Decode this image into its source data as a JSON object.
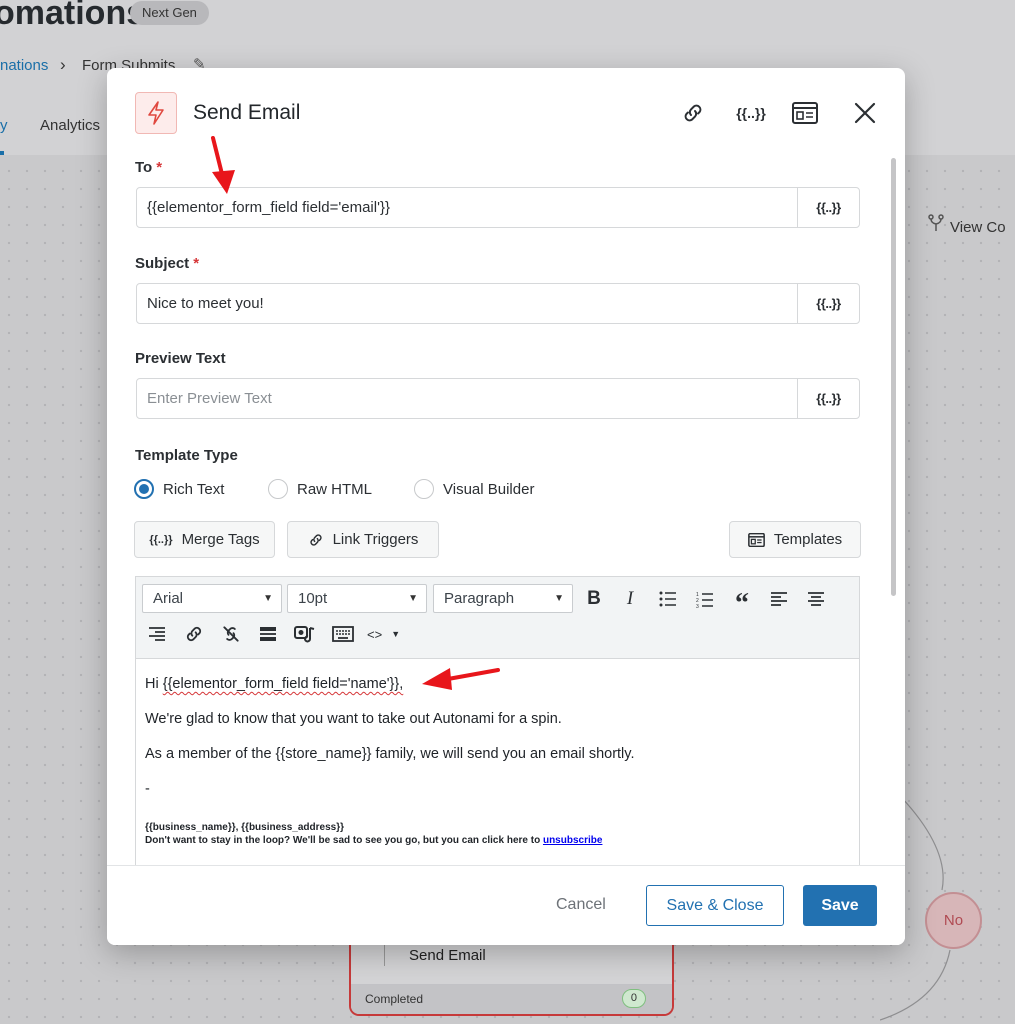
{
  "background": {
    "page_title": "omations",
    "badge": "Next Gen",
    "breadcrumb": {
      "parent": "nations",
      "current": "Form Submits"
    },
    "tabs": [
      {
        "label": "y",
        "active": true
      },
      {
        "label": "Analytics",
        "active": false
      }
    ],
    "view_button": "View Co",
    "node": {
      "title": "Send Email",
      "status": "Completed",
      "count": "0"
    },
    "branch_label": "No"
  },
  "modal": {
    "title": "Send Email",
    "header_icons": [
      "link-icon",
      "merge-tags-icon",
      "template-icon",
      "close-icon"
    ],
    "to": {
      "label": "To",
      "required_mark": "*",
      "value": "{{elementor_form_field field='email'}}",
      "merge_tag_button": "{{..}}"
    },
    "subject": {
      "label": "Subject",
      "required_mark": "*",
      "value": "Nice to meet you!",
      "merge_tag_button": "{{..}}"
    },
    "preview_text": {
      "label": "Preview Text",
      "placeholder": "Enter Preview Text",
      "merge_tag_button": "{{..}}"
    },
    "template_type": {
      "label": "Template Type",
      "options": [
        {
          "label": "Rich Text",
          "selected": true
        },
        {
          "label": "Raw HTML",
          "selected": false
        },
        {
          "label": "Visual Builder",
          "selected": false
        }
      ]
    },
    "actions": {
      "merge_tags": "Merge Tags",
      "merge_tags_icon_text": "{{..}}",
      "link_triggers": "Link Triggers",
      "templates": "Templates"
    },
    "editor": {
      "font": "Arial",
      "size": "10pt",
      "block": "Paragraph",
      "toolbar_icons": [
        "bold-icon",
        "italic-icon",
        "bullet-list-icon",
        "numbered-list-icon",
        "blockquote-icon",
        "align-left-icon",
        "align-center-icon",
        "align-right-icon",
        "link-icon",
        "unlink-icon",
        "horizontal-rule-icon",
        "media-icon",
        "keyboard-icon",
        "code-icon"
      ],
      "content": {
        "greeting_prefix": "Hi ",
        "greeting_tag": "{{elementor_form_field field='name'}},",
        "line2": "We're glad to know that you want to take out Autonami for a spin.",
        "line3": "As a member of the {{store_name}} family, we will send you an email shortly.",
        "line4": "-",
        "footer_line1": "{{business_name}}, {{business_address}}",
        "footer_line2": "Don't want to stay in the loop? We'll be sad to see you go, but you can click here to ",
        "footer_link": "unsubscribe"
      }
    },
    "footer": {
      "cancel": "Cancel",
      "save_close": "Save & Close",
      "save": "Save"
    }
  },
  "colors": {
    "accent": "#2271b1",
    "required": "#d63638",
    "annotation_arrow": "#e8161b"
  }
}
